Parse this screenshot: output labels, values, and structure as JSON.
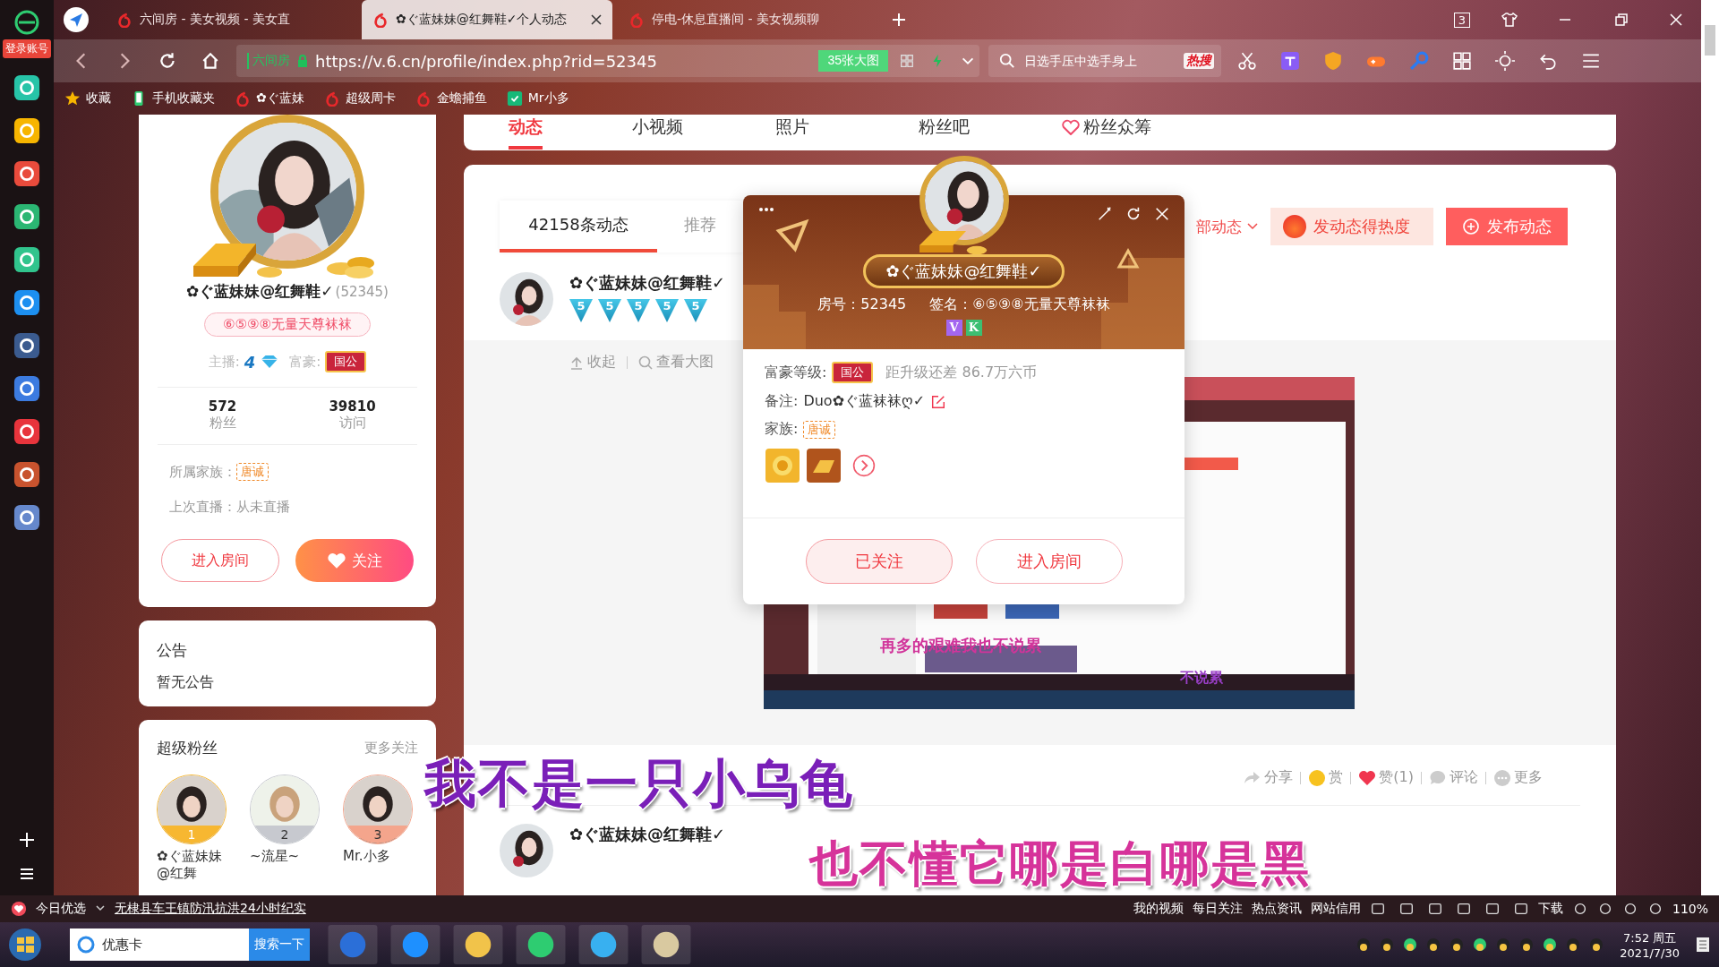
{
  "sidebar": {
    "login": "登录账号"
  },
  "tabs": [
    {
      "title": "六间房 - 美女视频 - 美女直",
      "selected": false
    },
    {
      "title": "✿ぐ蓝妹妹@红舞鞋✓个人动态",
      "selected": true
    },
    {
      "title": "停电-休息直播间 - 美女视频聊",
      "selected": false
    }
  ],
  "tab_count": "3",
  "address": {
    "cert": "六间房",
    "url": "https://v.6.cn/profile/index.php?rid=52345",
    "images": "35张大图"
  },
  "search": {
    "placeholder": "日选手压中选手身上",
    "hot": "热搜"
  },
  "bookmarks": [
    {
      "label": "收藏",
      "kind": "star"
    },
    {
      "label": "手机收藏夹",
      "kind": "phone"
    },
    {
      "label": "✿ぐ蓝妹",
      "kind": "six"
    },
    {
      "label": "超级周卡",
      "kind": "six"
    },
    {
      "label": "金蟾捕鱼",
      "kind": "six"
    },
    {
      "label": "Mr小多",
      "kind": "app"
    }
  ],
  "profile": {
    "name": "✿ぐ蓝妹妹@红舞鞋✓",
    "room_id": "(52345)",
    "signature": "⑥⑤⑨⑧无量天尊袜袜",
    "anchor_label": "主播:",
    "anchor_level": "4",
    "rich_label": "富豪:",
    "rich_badge": "国公",
    "stats": [
      {
        "value": "572",
        "label": "粉丝"
      },
      {
        "value": "39810",
        "label": "访问"
      }
    ],
    "family_label": "所属家族：",
    "family": "唐诚",
    "last_live": "上次直播：从未直播",
    "buttons": [
      "进入房间",
      "关注"
    ]
  },
  "notice": {
    "title": "公告",
    "text": "暂无公告"
  },
  "super_fans": {
    "title": "超级粉丝",
    "more": "更多关注",
    "fans": [
      {
        "rank": "1",
        "name": "✿ぐ蓝妹妹@红舞",
        "color": "#f7b731"
      },
      {
        "rank": "2",
        "name": "~流星~",
        "color": "#c7c9cf"
      },
      {
        "rank": "3",
        "name": "Mr.小多",
        "color": "#f4a58c"
      }
    ]
  },
  "nav": [
    {
      "label": "动态",
      "selected": true
    },
    {
      "label": "小视频",
      "selected": false
    },
    {
      "label": "照片",
      "selected": false
    },
    {
      "label": "粉丝吧",
      "selected": false
    },
    {
      "label": "粉丝众筹",
      "selected": false
    }
  ],
  "feed": {
    "tabs": [
      {
        "label": "42158条动态",
        "selected": true
      },
      {
        "label": "推荐",
        "selected": false
      }
    ],
    "filter": "部动态",
    "hot_button": "发动态得热度",
    "post_button": "发布动态",
    "post": {
      "name": "✿ぐ蓝妹妹@红舞鞋✓",
      "badges": [
        "5",
        "5",
        "5",
        "5",
        "5"
      ],
      "actions": [
        "收起",
        "查看大图"
      ],
      "image_texts": [
        "再多的艰难我也不说累",
        "不说累"
      ],
      "footer": [
        {
          "kind": "share",
          "label": "分享"
        },
        {
          "kind": "reward",
          "label": "赏"
        },
        {
          "kind": "like",
          "label": "赞(1)"
        },
        {
          "kind": "comment",
          "label": "评论"
        },
        {
          "kind": "more",
          "label": "更多"
        }
      ]
    },
    "next_post": {
      "name": "✿ぐ蓝妹妹@红舞鞋✓"
    }
  },
  "popup": {
    "name": "✿ぐ蓝妹妹@红舞鞋✓",
    "room": "房号：52345",
    "sign": "签名：⑥⑤⑨⑧无量天尊袜袜",
    "tags": [
      "V",
      "K"
    ],
    "rich_label": "富豪等级:",
    "rich_badge": "国公",
    "upgrade": "距升级还差 86.7万六币",
    "remark_label": "备注:",
    "remark": "Duo✿ぐ蓝袜袜ღ✓",
    "family_label": "家族:",
    "family": "唐诚",
    "buttons": [
      {
        "label": "已关注",
        "followed": true
      },
      {
        "label": "进入房间",
        "followed": false
      }
    ]
  },
  "subtitles": [
    "我不是一只小乌龟",
    "也不懂它哪是白哪是黑"
  ],
  "status_bar": {
    "left": [
      "今日优选",
      "无棣县车王镇防汛抗洪24小时纪实"
    ],
    "links": [
      "我的视频",
      "每日关注",
      "热点资讯",
      "网站信用"
    ],
    "download": "下载",
    "zoom": "110%"
  },
  "taskbar": {
    "search_value": "优惠卡",
    "search_button": "搜索一下",
    "time": "7:52 周五",
    "date": "2021/7/30"
  }
}
